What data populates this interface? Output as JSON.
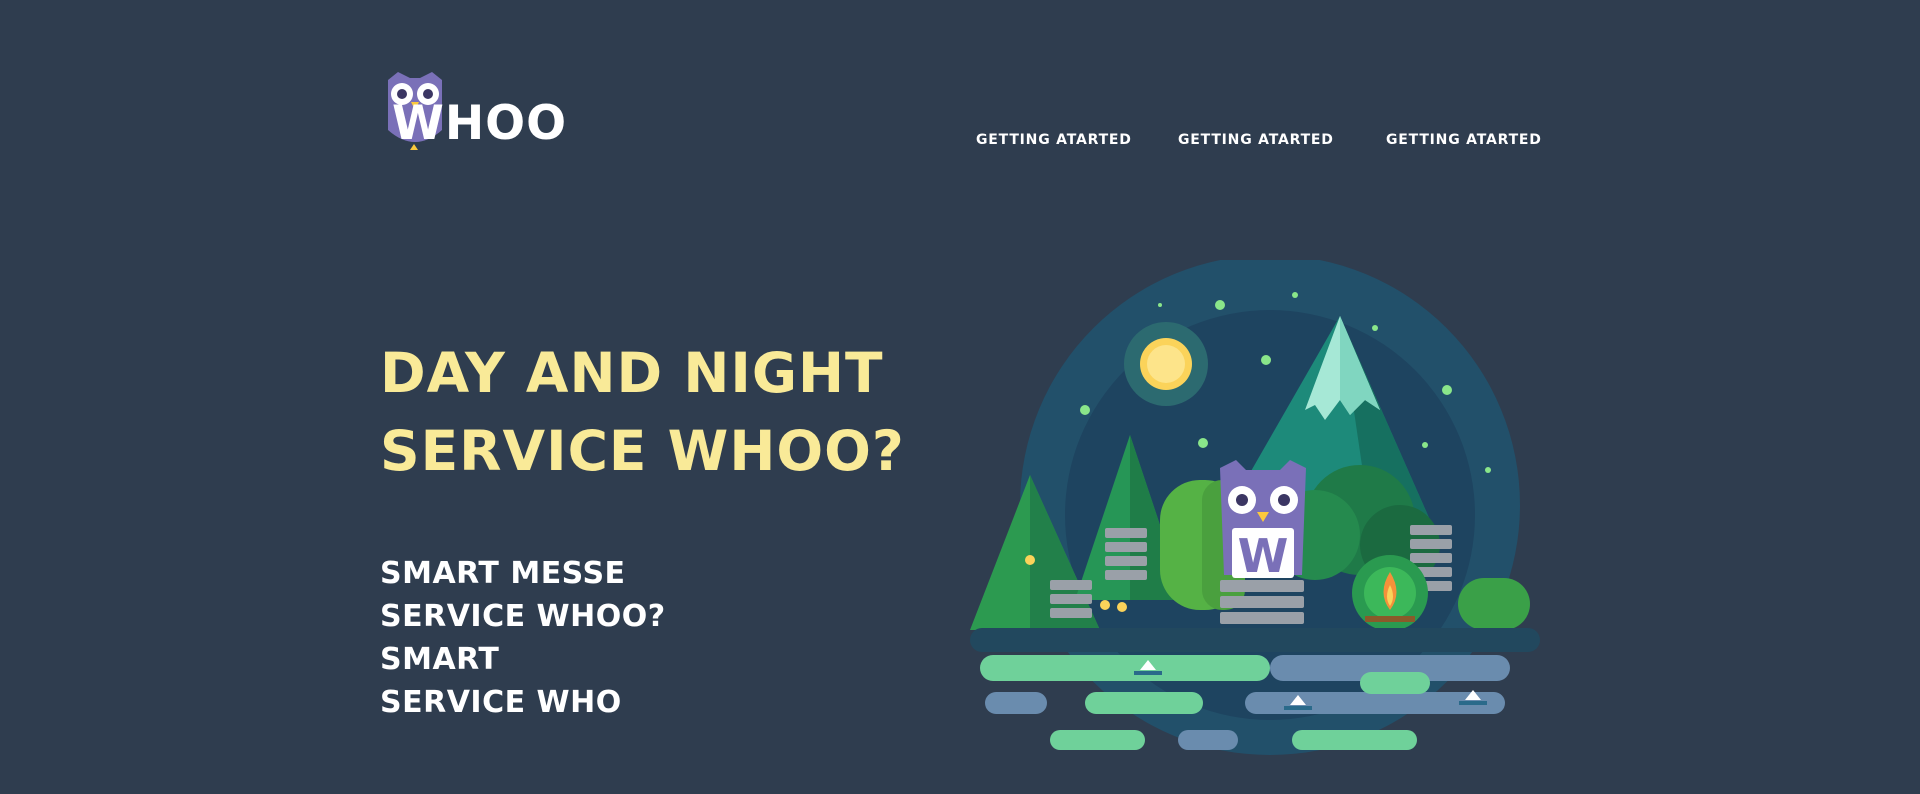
{
  "brand": {
    "name": "WHOO"
  },
  "nav": {
    "items": [
      {
        "label": "GETTING ATARTED"
      },
      {
        "label": "GETTING ATARTED"
      },
      {
        "label": "GETTING ATARTED"
      }
    ]
  },
  "hero": {
    "title_lines": [
      "DAY AND NIGHT",
      "SERVICE WHOO?"
    ],
    "subtitle_lines": [
      "SMART MESSE",
      "SERVICE WHOO?",
      "SMART",
      "SERVICE WHO"
    ]
  },
  "illustration": {
    "owl_letter": "W"
  },
  "colors": {
    "background": "#2f3d4f",
    "title": "#f9ea98",
    "text": "#ffffff",
    "owl": "#7a70b8",
    "moon": "#fbd35a"
  }
}
